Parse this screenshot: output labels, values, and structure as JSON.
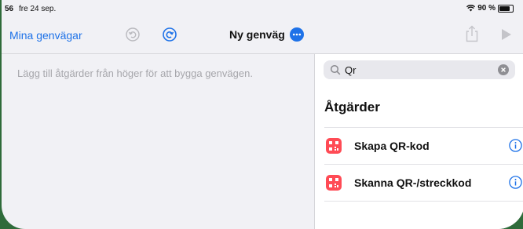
{
  "status_bar": {
    "time": "56",
    "date": "fre 24 sep.",
    "battery": "90 %"
  },
  "nav": {
    "back_label": "Mina genvägar",
    "title": "Ny genväg",
    "icons": [
      "undo-icon",
      "redo-icon",
      "more-icon",
      "share-icon",
      "play-icon"
    ]
  },
  "editor": {
    "hint": "Lägg till åtgärder från höger för att bygga genvägen."
  },
  "panel": {
    "search": {
      "value": "Qr"
    },
    "section_title": "Åtgärder",
    "actions": [
      {
        "label": "Skapa QR-kod",
        "icon": "qr-icon"
      },
      {
        "label": "Skanna QR-/streckkod",
        "icon": "qr-icon"
      }
    ]
  },
  "colors": {
    "accent": "#1e72e8",
    "background": "#f1f1f5",
    "frame": "#2f6b3a",
    "action_icon": "#ff4b55"
  }
}
